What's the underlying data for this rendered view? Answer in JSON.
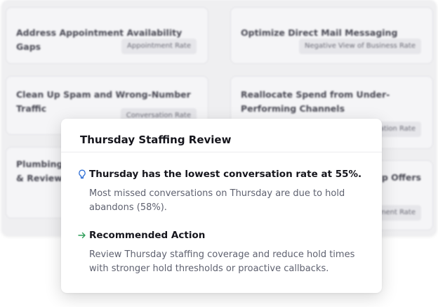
{
  "background_cards": [
    {
      "title": "Address Appointment Availability Gaps",
      "tag": "Appointment Rate"
    },
    {
      "title": "Optimize Direct Mail Messaging",
      "tag": "Negative View of Business Rate"
    },
    {
      "title": "Clean Up Spam and Wrong-Number Traffic",
      "tag": "Conversation Rate"
    },
    {
      "title": "Reallocate Spend from Under-Performing Channels",
      "tag": "ation Rate"
    },
    {
      "title": "Plumbing & Review",
      "tag": ""
    },
    {
      "title": "p Offers",
      "tag": "ment Rate"
    }
  ],
  "popup": {
    "title": "Thursday Staffing Review",
    "insight": {
      "icon": "lightbulb-icon",
      "icon_color": "#2f6fd6",
      "title": "Thursday has the lowest conversation rate at 55%.",
      "body": "Most missed conversations on Thursday are due to hold abandons (58%)."
    },
    "action": {
      "icon": "arrow-right-icon",
      "icon_color": "#2f9e5a",
      "title": "Recommended Action",
      "body": "Review Thursday staffing coverage and reduce hold times with stronger hold thresholds or proactive callbacks."
    }
  }
}
